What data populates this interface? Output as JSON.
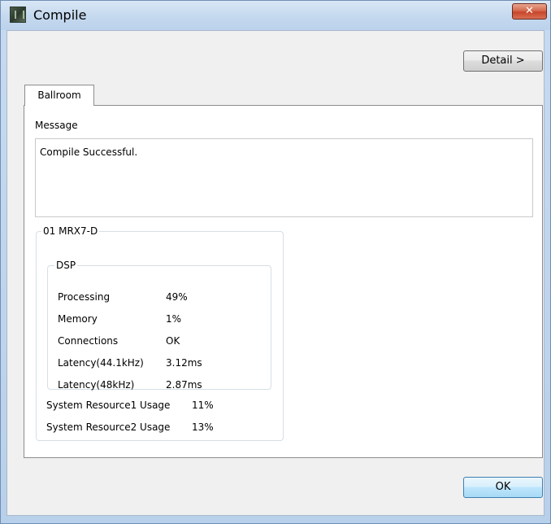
{
  "window": {
    "title": "Compile",
    "close_glyph": "✕",
    "app_icon": "app-icon"
  },
  "buttons": {
    "detail": "Detail >",
    "ok": "OK"
  },
  "tabs": [
    {
      "label": "Ballroom",
      "selected": true
    }
  ],
  "message": {
    "label": "Message",
    "text": "Compile Successful."
  },
  "device": {
    "name": "01 MRX7-D",
    "dsp": {
      "label": "DSP",
      "rows": [
        {
          "label": "Processing",
          "value": "49%"
        },
        {
          "label": "Memory",
          "value": "1%"
        },
        {
          "label": "Connections",
          "value": "OK"
        },
        {
          "label": "Latency(44.1kHz)",
          "value": "3.12ms"
        },
        {
          "label": "Latency(48kHz)",
          "value": "2.87ms"
        }
      ]
    },
    "system_resources": [
      {
        "label": "System Resource1 Usage",
        "value": "11%"
      },
      {
        "label": "System Resource2 Usage",
        "value": "13%"
      }
    ]
  }
}
